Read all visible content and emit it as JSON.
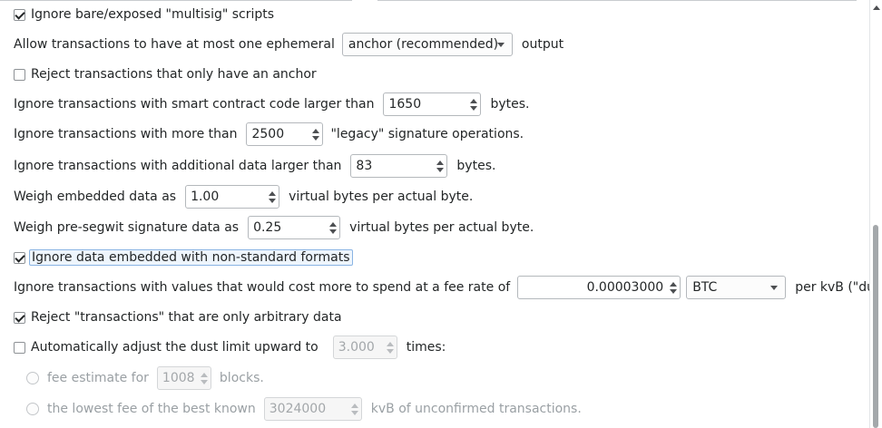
{
  "options": {
    "ignore_bare_multisig": {
      "label": "Ignore bare/exposed \"multisig\" scripts",
      "checked": true
    },
    "ephemeral": {
      "prefix": "Allow transactions to have at most one ephemeral",
      "selected": "anchor (recommended)",
      "suffix": "output"
    },
    "reject_only_anchor": {
      "label": "Reject transactions that only have an anchor",
      "checked": false
    },
    "contract_code": {
      "prefix": "Ignore transactions with smart contract code larger than",
      "value": "1650",
      "suffix": "bytes."
    },
    "legacy_sigops": {
      "prefix": "Ignore transactions with more than",
      "value": "2500",
      "suffix": "\"legacy\" signature operations."
    },
    "additional_data": {
      "prefix": "Ignore transactions with additional data larger than",
      "value": "83",
      "suffix": "bytes."
    },
    "embedded_weight": {
      "prefix": "Weigh embedded data as",
      "value": "1.00",
      "suffix": "virtual bytes per actual byte."
    },
    "presegwit_weight": {
      "prefix": "Weigh pre-segwit signature data as",
      "value": "0.25",
      "suffix": "virtual bytes per actual byte."
    },
    "nonstandard_data": {
      "label": "Ignore data embedded with non-standard formats",
      "checked": true
    },
    "dust": {
      "prefix": "Ignore transactions with values that would cost more to spend at a fee rate of",
      "value": "0.00003000",
      "unit": "BTC",
      "suffix": "per kvB (\"dust\")."
    },
    "reject_arbitrary": {
      "label": "Reject \"transactions\" that are only arbitrary data",
      "checked": true
    },
    "dust_adjust": {
      "label": "Automatically adjust the dust limit upward to",
      "checked": false,
      "value": "3.000",
      "suffix": "times:"
    },
    "fee_estimate": {
      "prefix": "fee estimate for",
      "value": "1008",
      "suffix": "blocks."
    },
    "lowest_fee": {
      "prefix": "the lowest fee of the best known",
      "value": "3024000",
      "suffix": "kvB of unconfirmed transactions."
    }
  }
}
